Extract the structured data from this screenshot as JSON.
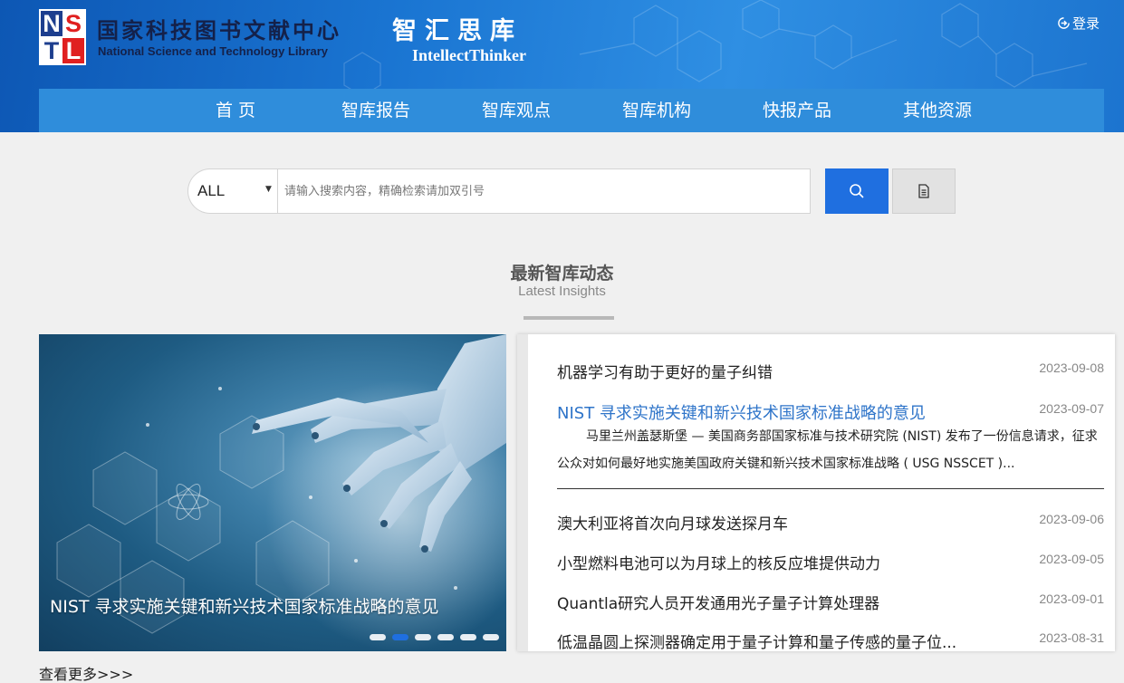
{
  "header": {
    "logo": {
      "n": "N",
      "s": "S",
      "t": "T",
      "l": "L"
    },
    "org_cn": "国家科技图书文献中心",
    "org_en": "National Science and Technology Library",
    "brand_cn": "智汇思库",
    "brand_en": "IntellectThinker",
    "login_label": "登录"
  },
  "nav": {
    "items": [
      {
        "label": "首 页"
      },
      {
        "label": "智库报告"
      },
      {
        "label": "智库观点"
      },
      {
        "label": "智库机构"
      },
      {
        "label": "快报产品"
      },
      {
        "label": "其他资源"
      }
    ]
  },
  "search": {
    "scope_value": "ALL",
    "placeholder": "请输入搜索内容，精确检索请加双引号"
  },
  "section": {
    "title": "最新智库动态",
    "subtitle": "Latest Insights"
  },
  "carousel": {
    "caption": "NIST 寻求实施关键和新兴技术国家标准战略的意见",
    "slide_count": 6,
    "active_index": 1
  },
  "more_label": "查看更多>>>",
  "news": {
    "items": [
      {
        "title": "机器学习有助于更好的量子纠错",
        "date": "2023-09-08"
      },
      {
        "title": "NIST 寻求实施关键和新兴技术国家标准战略的意见",
        "date": "2023-09-07",
        "highlighted": true
      },
      {
        "title": "澳大利亚将首次向月球发送探月车",
        "date": "2023-09-06"
      },
      {
        "title": "小型燃料电池可以为月球上的核反应堆提供动力",
        "date": "2023-09-05"
      },
      {
        "title": "Quantla研究人员开发通用光子量子计算处理器",
        "date": "2023-09-01"
      },
      {
        "title": "低温晶圆上探测器确定用于量子计算和量子传感的量子位...",
        "date": "2023-08-31"
      }
    ],
    "summary": "马里兰州盖瑟斯堡 — 美国商务部国家标准与技术研究院 (NIST) 发布了一份信息请求，征求公众对如何最好地实施美国政府关键和新兴技术国家标准战略 ( USG NSSCET )..."
  },
  "colors": {
    "header_blue": "#1a75d2",
    "nav_blue": "#2f8ddb",
    "button_blue": "#1f6fe0",
    "link_blue": "#2e74c9"
  }
}
